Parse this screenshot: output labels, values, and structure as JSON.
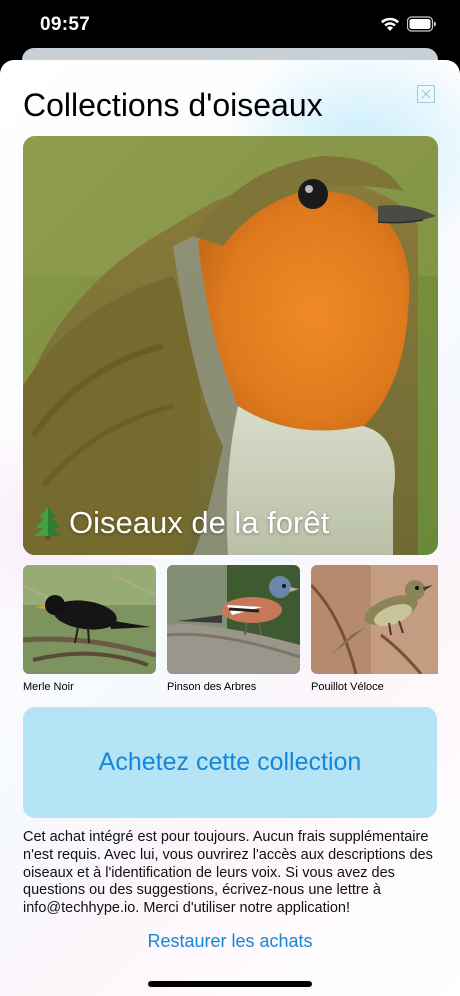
{
  "status_bar": {
    "time": "09:57"
  },
  "title": "Collections d'oiseaux",
  "hero": {
    "label": "Oiseaux de la forêt",
    "icon": "evergreen-tree-icon"
  },
  "birds": [
    {
      "name": "Merle Noir"
    },
    {
      "name": "Pinson des Arbres"
    },
    {
      "name": "Pouillot Véloce"
    }
  ],
  "buy_button": "Achetez cette collection",
  "description": "Cet achat intégré est pour toujours. Aucun frais supplémentaire n'est requis. Avec lui, vous ouvrirez l'accès aux descriptions des oiseaux et à l'identification de leurs voix. Si vous avez des questions ou des suggestions, écrivez-nous une lettre à info@techhype.io. Merci d'utiliser notre application!",
  "restore_link": "Restaurer les achats",
  "colors": {
    "accent": "#1587d8",
    "button_bg": "#b4e4f5"
  }
}
